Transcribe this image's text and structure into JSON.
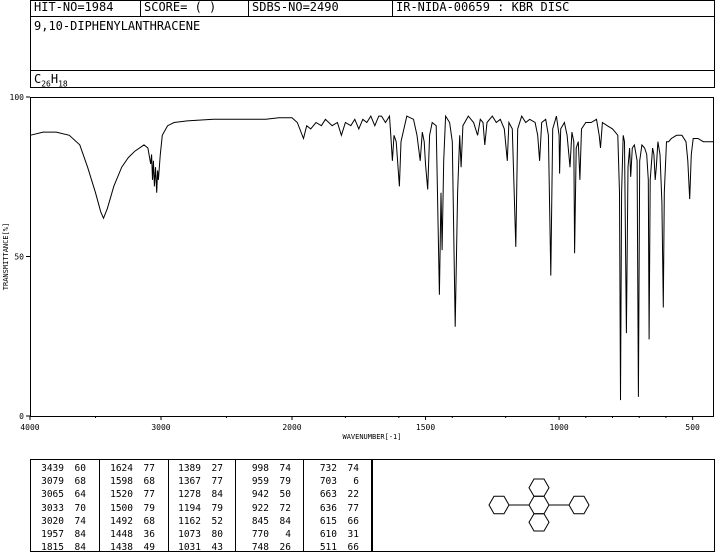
{
  "header": {
    "hit_no": "HIT-NO=1984",
    "score": "SCORE=  (   )",
    "sdbs_no": "SDBS-NO=2490",
    "ir_nida": "IR-NIDA-00659 : KBR DISC",
    "compound_name": "9,10-DIPHENYLANTHRACENE",
    "formula_c": "C",
    "formula_c_sub": "26",
    "formula_h": "H",
    "formula_h_sub": "18"
  },
  "chart_data": {
    "type": "line",
    "title": "",
    "xlabel": "WAVENUMBER[-1]",
    "ylabel": "TRANSMITTANCE[%]",
    "xlim": [
      4000,
      420
    ],
    "ylim": [
      0,
      100
    ],
    "x_ticks": [
      "4000",
      "3000",
      "2000",
      "1500",
      "1000",
      "500"
    ],
    "x_tick_values": [
      4000,
      3000,
      2000,
      1500,
      1000,
      500
    ],
    "y_ticks": [
      "0",
      "50",
      "100"
    ],
    "y_tick_values": [
      0,
      50,
      100
    ],
    "series": [
      {
        "points": [
          [
            4000,
            88
          ],
          [
            3900,
            89
          ],
          [
            3800,
            89
          ],
          [
            3700,
            88
          ],
          [
            3620,
            85
          ],
          [
            3560,
            78
          ],
          [
            3500,
            70
          ],
          [
            3460,
            64
          ],
          [
            3439,
            62
          ],
          [
            3410,
            65
          ],
          [
            3360,
            72
          ],
          [
            3300,
            78
          ],
          [
            3250,
            81
          ],
          [
            3200,
            83
          ],
          [
            3130,
            85
          ],
          [
            3100,
            84
          ],
          [
            3079,
            79
          ],
          [
            3072,
            82
          ],
          [
            3065,
            74
          ],
          [
            3058,
            80
          ],
          [
            3050,
            72
          ],
          [
            3042,
            78
          ],
          [
            3033,
            70
          ],
          [
            3026,
            77
          ],
          [
            3020,
            74
          ],
          [
            3005,
            82
          ],
          [
            2990,
            88
          ],
          [
            2950,
            91
          ],
          [
            2900,
            92
          ],
          [
            2800,
            92.5
          ],
          [
            2600,
            93
          ],
          [
            2400,
            93
          ],
          [
            2200,
            93
          ],
          [
            2100,
            93.5
          ],
          [
            2000,
            93.5
          ],
          [
            1980,
            92
          ],
          [
            1957,
            87
          ],
          [
            1945,
            91
          ],
          [
            1930,
            90
          ],
          [
            1910,
            92
          ],
          [
            1890,
            91
          ],
          [
            1875,
            93
          ],
          [
            1850,
            91
          ],
          [
            1830,
            92
          ],
          [
            1815,
            88
          ],
          [
            1800,
            92
          ],
          [
            1780,
            91
          ],
          [
            1765,
            93
          ],
          [
            1750,
            90
          ],
          [
            1735,
            93
          ],
          [
            1720,
            92
          ],
          [
            1705,
            94
          ],
          [
            1690,
            91
          ],
          [
            1675,
            94
          ],
          [
            1665,
            94
          ],
          [
            1650,
            92
          ],
          [
            1635,
            94
          ],
          [
            1630,
            88
          ],
          [
            1624,
            80
          ],
          [
            1618,
            88
          ],
          [
            1610,
            86
          ],
          [
            1598,
            72
          ],
          [
            1592,
            86
          ],
          [
            1570,
            94
          ],
          [
            1545,
            93
          ],
          [
            1532,
            88
          ],
          [
            1520,
            80
          ],
          [
            1512,
            89
          ],
          [
            1505,
            86
          ],
          [
            1500,
            79
          ],
          [
            1492,
            71
          ],
          [
            1485,
            88
          ],
          [
            1475,
            92
          ],
          [
            1460,
            91
          ],
          [
            1448,
            38
          ],
          [
            1442,
            70
          ],
          [
            1438,
            52
          ],
          [
            1432,
            80
          ],
          [
            1425,
            94
          ],
          [
            1410,
            92
          ],
          [
            1400,
            86
          ],
          [
            1389,
            28
          ],
          [
            1380,
            70
          ],
          [
            1372,
            88
          ],
          [
            1367,
            78
          ],
          [
            1360,
            91
          ],
          [
            1340,
            94
          ],
          [
            1320,
            92
          ],
          [
            1305,
            88
          ],
          [
            1295,
            93
          ],
          [
            1285,
            92
          ],
          [
            1278,
            85
          ],
          [
            1270,
            92
          ],
          [
            1250,
            94
          ],
          [
            1235,
            92
          ],
          [
            1220,
            93
          ],
          [
            1205,
            90
          ],
          [
            1194,
            80
          ],
          [
            1188,
            92
          ],
          [
            1175,
            90
          ],
          [
            1162,
            53
          ],
          [
            1155,
            90
          ],
          [
            1140,
            94
          ],
          [
            1125,
            92
          ],
          [
            1110,
            93
          ],
          [
            1090,
            92
          ],
          [
            1080,
            88
          ],
          [
            1073,
            80
          ],
          [
            1065,
            92
          ],
          [
            1050,
            93
          ],
          [
            1040,
            88
          ],
          [
            1031,
            44
          ],
          [
            1024,
            90
          ],
          [
            1010,
            94
          ],
          [
            1000,
            88
          ],
          [
            998,
            76
          ],
          [
            994,
            90
          ],
          [
            980,
            92
          ],
          [
            970,
            88
          ],
          [
            959,
            78
          ],
          [
            952,
            89
          ],
          [
            945,
            86
          ],
          [
            942,
            51
          ],
          [
            936,
            84
          ],
          [
            928,
            86
          ],
          [
            922,
            74
          ],
          [
            916,
            90
          ],
          [
            900,
            92
          ],
          [
            880,
            92
          ],
          [
            860,
            93
          ],
          [
            850,
            88
          ],
          [
            845,
            84
          ],
          [
            838,
            92
          ],
          [
            820,
            91
          ],
          [
            800,
            90
          ],
          [
            790,
            89
          ],
          [
            780,
            88
          ],
          [
            774,
            70
          ],
          [
            770,
            5
          ],
          [
            766,
            70
          ],
          [
            760,
            88
          ],
          [
            755,
            86
          ],
          [
            748,
            26
          ],
          [
            742,
            78
          ],
          [
            736,
            84
          ],
          [
            732,
            75
          ],
          [
            726,
            84
          ],
          [
            718,
            85
          ],
          [
            708,
            80
          ],
          [
            703,
            6
          ],
          [
            698,
            80
          ],
          [
            690,
            85
          ],
          [
            680,
            84
          ],
          [
            672,
            82
          ],
          [
            666,
            74
          ],
          [
            663,
            24
          ],
          [
            659,
            74
          ],
          [
            650,
            84
          ],
          [
            645,
            82
          ],
          [
            640,
            74
          ],
          [
            636,
            78
          ],
          [
            630,
            86
          ],
          [
            622,
            82
          ],
          [
            615,
            67
          ],
          [
            610,
            34
          ],
          [
            606,
            70
          ],
          [
            598,
            86
          ],
          [
            590,
            86
          ],
          [
            580,
            87
          ],
          [
            560,
            88
          ],
          [
            540,
            88
          ],
          [
            525,
            86
          ],
          [
            518,
            80
          ],
          [
            511,
            68
          ],
          [
            505,
            82
          ],
          [
            498,
            87
          ],
          [
            480,
            87
          ],
          [
            460,
            86
          ],
          [
            440,
            86
          ],
          [
            420,
            86
          ]
        ]
      }
    ]
  },
  "peak_table": {
    "columns": [
      [
        [
          "3439",
          "60"
        ],
        [
          "3079",
          "68"
        ],
        [
          "3065",
          "64"
        ],
        [
          "3033",
          "70"
        ],
        [
          "3020",
          "74"
        ],
        [
          "1957",
          "84"
        ],
        [
          "1815",
          "84"
        ]
      ],
      [
        [
          "1624",
          "77"
        ],
        [
          "1598",
          "68"
        ],
        [
          "1520",
          "77"
        ],
        [
          "1500",
          "79"
        ],
        [
          "1492",
          "68"
        ],
        [
          "1448",
          "36"
        ],
        [
          "1438",
          "49"
        ]
      ],
      [
        [
          "1389",
          "27"
        ],
        [
          "1367",
          "77"
        ],
        [
          "1278",
          "84"
        ],
        [
          "1194",
          "79"
        ],
        [
          "1162",
          "52"
        ],
        [
          "1073",
          "80"
        ],
        [
          "1031",
          "43"
        ]
      ],
      [
        [
          "998",
          "74"
        ],
        [
          "959",
          "79"
        ],
        [
          "942",
          "50"
        ],
        [
          "922",
          "72"
        ],
        [
          "845",
          "84"
        ],
        [
          "770",
          "4"
        ],
        [
          "748",
          "26"
        ]
      ],
      [
        [
          "732",
          "74"
        ],
        [
          "703",
          "6"
        ],
        [
          "663",
          "22"
        ],
        [
          "636",
          "77"
        ],
        [
          "615",
          "66"
        ],
        [
          "610",
          "31"
        ],
        [
          "511",
          "66"
        ]
      ]
    ]
  }
}
